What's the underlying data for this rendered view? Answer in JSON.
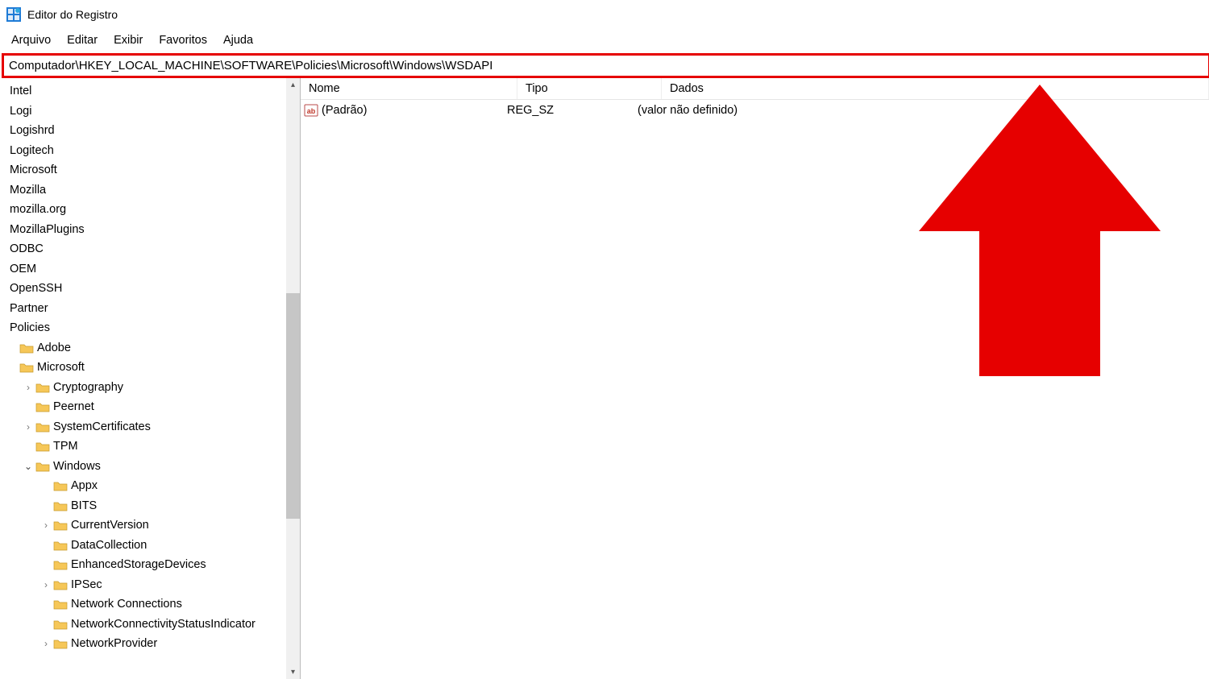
{
  "titlebar": {
    "title": "Editor do Registro"
  },
  "menu": {
    "arquivo": "Arquivo",
    "editar": "Editar",
    "exibir": "Exibir",
    "favoritos": "Favoritos",
    "ajuda": "Ajuda"
  },
  "addressbar": {
    "path": "Computador\\HKEY_LOCAL_MACHINE\\SOFTWARE\\Policies\\Microsoft\\Windows\\WSDAPI"
  },
  "tree": {
    "top_plain": [
      "Intel",
      "Logi",
      "Logishrd",
      "Logitech",
      "Microsoft",
      "Mozilla",
      "mozilla.org",
      "MozillaPlugins",
      "ODBC",
      "OEM",
      "OpenSSH",
      "Partner",
      "Policies"
    ],
    "l1": {
      "adobe": "Adobe",
      "microsoft": "Microsoft"
    },
    "l2": {
      "cryptography": "Cryptography",
      "peernet": "Peernet",
      "systemcertificates": "SystemCertificates",
      "tpm": "TPM",
      "windows": "Windows"
    },
    "l3": {
      "appx": "Appx",
      "bits": "BITS",
      "currentversion": "CurrentVersion",
      "datacollection": "DataCollection",
      "enhancedstoragedevices": "EnhancedStorageDevices",
      "ipsec": "IPSec",
      "networkconnections": "Network Connections",
      "networkconnectivity": "NetworkConnectivityStatusIndicator",
      "networkprovider": "NetworkProvider"
    }
  },
  "list": {
    "headers": {
      "nome": "Nome",
      "tipo": "Tipo",
      "dados": "Dados"
    },
    "row": {
      "nome": "(Padrão)",
      "tipo": "REG_SZ",
      "dados": "(valor não definido)"
    }
  }
}
